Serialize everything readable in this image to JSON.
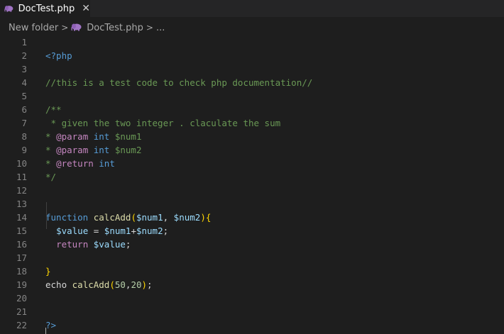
{
  "tab": {
    "label": "DocTest.php",
    "close_glyph": "✕",
    "icon": "php-elephant-icon",
    "icon_color": "#a074c4"
  },
  "breadcrumb": {
    "folder": "New folder",
    "separator": ">",
    "file": "DocTest.php",
    "more": "..."
  },
  "editor": {
    "lines": [
      {
        "n": "1",
        "tokens": []
      },
      {
        "n": "2",
        "tokens": [
          {
            "c": "tag",
            "t": "<?php"
          }
        ]
      },
      {
        "n": "3",
        "tokens": []
      },
      {
        "n": "4",
        "tokens": [
          {
            "c": "cmt",
            "t": "//this is a test code to check php documentation//"
          }
        ]
      },
      {
        "n": "5",
        "tokens": []
      },
      {
        "n": "6",
        "tokens": [
          {
            "c": "cmt",
            "t": "/**"
          }
        ]
      },
      {
        "n": "7",
        "tokens": [
          {
            "c": "cmt",
            "t": " * given the two integer . claculate the sum"
          }
        ]
      },
      {
        "n": "8",
        "tokens": [
          {
            "c": "cmt",
            "t": "* "
          },
          {
            "c": "ctl",
            "t": "@param"
          },
          {
            "c": "cmt",
            "t": " "
          },
          {
            "c": "kw",
            "t": "int"
          },
          {
            "c": "cmt",
            "t": " $num1"
          }
        ]
      },
      {
        "n": "9",
        "tokens": [
          {
            "c": "cmt",
            "t": "* "
          },
          {
            "c": "ctl",
            "t": "@param"
          },
          {
            "c": "cmt",
            "t": " "
          },
          {
            "c": "kw",
            "t": "int"
          },
          {
            "c": "cmt",
            "t": " $num2"
          }
        ]
      },
      {
        "n": "10",
        "tokens": [
          {
            "c": "cmt",
            "t": "* "
          },
          {
            "c": "ctl",
            "t": "@return"
          },
          {
            "c": "cmt",
            "t": " "
          },
          {
            "c": "kw",
            "t": "int"
          }
        ]
      },
      {
        "n": "11",
        "tokens": [
          {
            "c": "cmt",
            "t": "*/"
          }
        ]
      },
      {
        "n": "12",
        "tokens": []
      },
      {
        "n": "13",
        "tokens": []
      },
      {
        "n": "14",
        "tokens": [
          {
            "c": "kw",
            "t": "function"
          },
          {
            "c": "plain",
            "t": " "
          },
          {
            "c": "fn",
            "t": "calcAdd"
          },
          {
            "c": "br1",
            "t": "("
          },
          {
            "c": "var",
            "t": "$num1"
          },
          {
            "c": "plain",
            "t": ", "
          },
          {
            "c": "var",
            "t": "$num2"
          },
          {
            "c": "br1",
            "t": ")"
          },
          {
            "c": "br1",
            "t": "{"
          }
        ]
      },
      {
        "n": "15",
        "tokens": [
          {
            "c": "plain",
            "t": "  "
          },
          {
            "c": "var",
            "t": "$value"
          },
          {
            "c": "plain",
            "t": " = "
          },
          {
            "c": "var",
            "t": "$num1"
          },
          {
            "c": "plain",
            "t": "+"
          },
          {
            "c": "var",
            "t": "$num2"
          },
          {
            "c": "plain",
            "t": ";"
          }
        ]
      },
      {
        "n": "16",
        "tokens": [
          {
            "c": "plain",
            "t": "  "
          },
          {
            "c": "ctl",
            "t": "return"
          },
          {
            "c": "plain",
            "t": " "
          },
          {
            "c": "var",
            "t": "$value"
          },
          {
            "c": "plain",
            "t": ";"
          }
        ]
      },
      {
        "n": "17",
        "tokens": []
      },
      {
        "n": "18",
        "tokens": [
          {
            "c": "br1",
            "t": "}"
          }
        ]
      },
      {
        "n": "19",
        "tokens": [
          {
            "c": "plain",
            "t": "echo "
          },
          {
            "c": "fn",
            "t": "calcAdd"
          },
          {
            "c": "br1",
            "t": "("
          },
          {
            "c": "num",
            "t": "50"
          },
          {
            "c": "plain",
            "t": ","
          },
          {
            "c": "num",
            "t": "20"
          },
          {
            "c": "br1",
            "t": ")"
          },
          {
            "c": "plain",
            "t": ";"
          }
        ]
      },
      {
        "n": "20",
        "tokens": []
      },
      {
        "n": "21",
        "tokens": []
      },
      {
        "n": "22",
        "tokens": [
          {
            "c": "tag",
            "t": "?>"
          }
        ]
      }
    ]
  },
  "colors": {
    "background": "#1e1e1e",
    "tabbar": "#252526",
    "line_number": "#858585",
    "comment": "#6a9955",
    "keyword": "#569cd6",
    "function": "#dcdcaa",
    "variable": "#9cdcfe",
    "number": "#b5cea8",
    "control": "#c586c0",
    "bracket": "#ffd700"
  }
}
